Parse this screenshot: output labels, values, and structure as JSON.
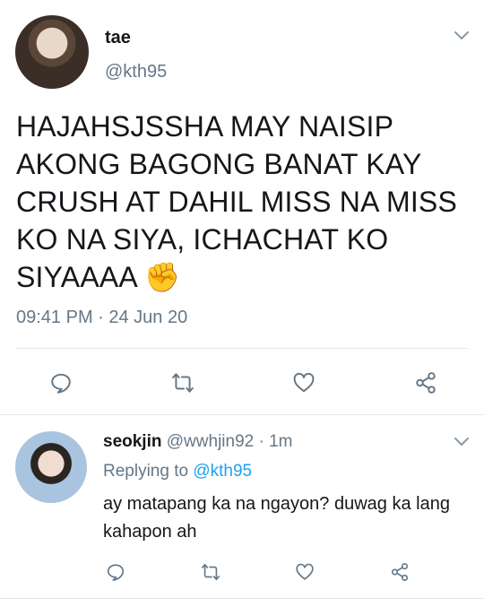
{
  "tweet": {
    "display_name": "tae",
    "handle": "@kth95",
    "text": "HAJAHSJSSHA MAY NAISIP AKONG BAGONG BANAT KAY CRUSH AT DAHIL MISS NA MISS KO NA SIYA, ICHACHAT KO SIYAAAA",
    "emoji": "✊",
    "timestamp": "09:41 PM · 24 Jun 20"
  },
  "reply": {
    "display_name": "seokjin",
    "handle": "@wwhjin92",
    "separator": "·",
    "time": "1m",
    "replying_prefix": "Replying to",
    "replying_to": "@kth95",
    "text": "ay matapang ka na ngayon? duwag ka lang kahapon ah"
  },
  "icons": {
    "reply": "speech-bubble-icon",
    "retweet": "retweet-icon",
    "like": "heart-icon",
    "share": "share-icon",
    "more": "chevron-down-icon"
  },
  "colors": {
    "text": "#14171a",
    "secondary": "#657786",
    "link": "#1da1f2",
    "divider": "#e1e8ed"
  }
}
